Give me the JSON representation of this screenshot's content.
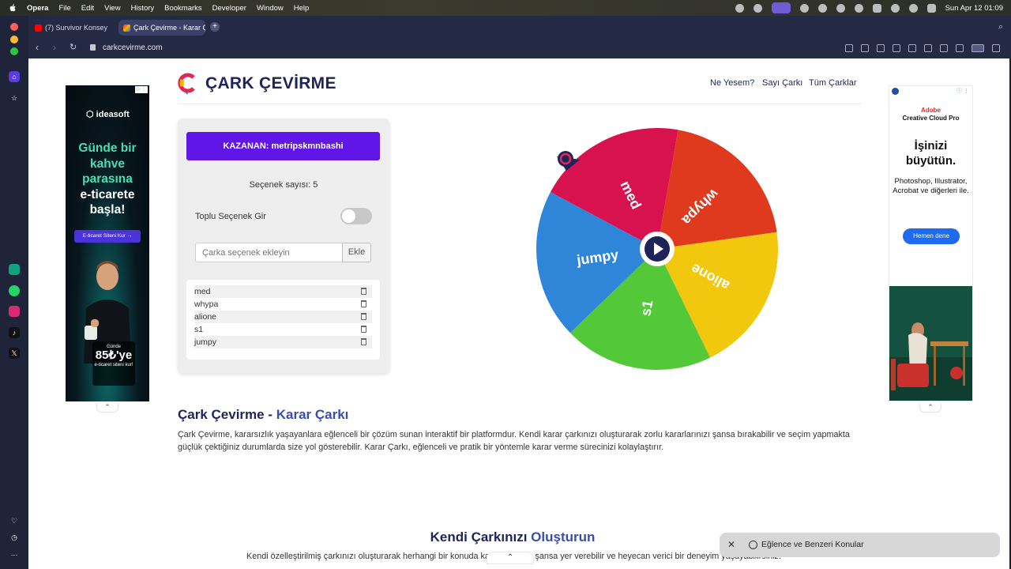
{
  "menubar": {
    "app": "Opera",
    "items": [
      "File",
      "Edit",
      "View",
      "History",
      "Bookmarks",
      "Developer",
      "Window",
      "Help"
    ],
    "datetime": "Sun Apr 12  01:09"
  },
  "tabs": [
    {
      "label": "(7) Survivor Konsey",
      "active": false
    },
    {
      "label": "Çark Çevirme - Karar Ça",
      "active": true
    }
  ],
  "addressbar": {
    "url": "carkcevirme.com"
  },
  "ads": {
    "left": {
      "brand": "ideasoft",
      "headline_green": "Günde bir kahve parasına",
      "headline_white": "e-ticarete başla!",
      "cta": "E-ticaret Siteni Kur →",
      "promo_small": "Günde",
      "promo_big": "85₺'ye",
      "promo_tail": "e-ticaret siteni kur!"
    },
    "right": {
      "brand_line1": "Adobe",
      "brand_line2": "Creative Cloud Pro",
      "headline": "İşinizi büyütün.",
      "description": "Photoshop, Illustrator, Acrobat ve diğerleri ile.",
      "cta": "Hemen dene"
    }
  },
  "site": {
    "logo_text": "ÇARK ÇEVİRME",
    "nav": [
      "Ne Yesem?",
      "Sayı Çarkı",
      "Tüm Çarklar"
    ]
  },
  "panel": {
    "winner": "KAZANAN: metripskmnbashi",
    "count_label": "Seçenek sayısı: 5",
    "bulk_label": "Toplu Seçenek Gir",
    "input_placeholder": "Çarka seçenek ekleyin",
    "add_button": "Ekle",
    "items": [
      "med",
      "whypa",
      "alione",
      "s1",
      "jumpy"
    ]
  },
  "wheel": {
    "segments": [
      {
        "label": "med",
        "color": "#d8124f"
      },
      {
        "label": "whypa",
        "color": "#e03a1e"
      },
      {
        "label": "alione",
        "color": "#f2c80f"
      },
      {
        "label": "s1",
        "color": "#53c93a"
      },
      {
        "label": "jumpy",
        "color": "#2f86d8"
      }
    ]
  },
  "content": {
    "section1_title_a": "Çark Çevirme - ",
    "section1_title_b": "Karar Çarkı",
    "section1_text": "Çark Çevirme, kararsızlık yaşayanlara eğlenceli bir çözüm sunan interaktif bir platformdur. Kendi karar çarkınızı oluşturarak zorlu kararlarınızı şansa bırakabilir ve seçim yapmakta güçlük çektiğiniz durumlarda size yol gösterebilir. Karar Çarkı, eğlenceli ve pratik bir yöntemle karar verme sürecinizi kolaylaştırır.",
    "section2_title_a": "Kendi Çarkınızı ",
    "section2_title_b": "Oluşturun",
    "section2_text": "Kendi özelleştirilmiş çarkınızı oluşturarak herhangi bir konuda karar verirken şansa yer verebilir ve heyecan verici bir deneyim yaşayabilirsiniz."
  },
  "toast": {
    "label": "Eğlence ve Benzeri Konular"
  }
}
